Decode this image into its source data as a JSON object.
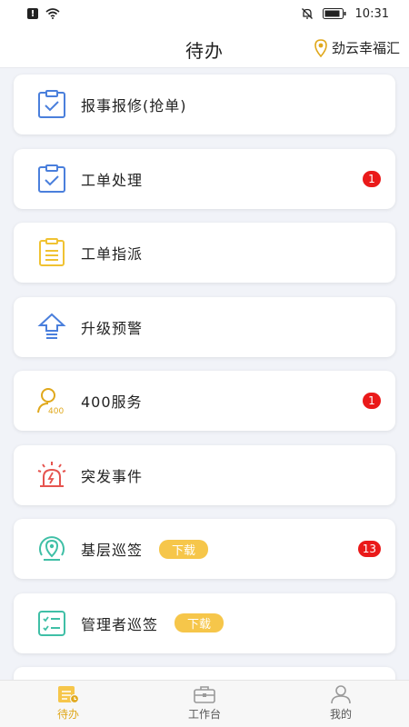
{
  "status_bar": {
    "time": "10:31"
  },
  "header": {
    "title": "待办",
    "location": "劲云幸福汇"
  },
  "items": [
    {
      "label": "报事报修(抢单)",
      "icon": "clipboard-check-icon",
      "color": "#4a7fdc"
    },
    {
      "label": "工单处理",
      "icon": "clipboard-check-icon",
      "color": "#4a7fdc",
      "badge": "1"
    },
    {
      "label": "工单指派",
      "icon": "clipboard-list-icon",
      "color": "#f0c232"
    },
    {
      "label": "升级预警",
      "icon": "upgrade-arrow-icon",
      "color": "#4a7fdc"
    },
    {
      "label": "400服务",
      "icon": "service-400-icon",
      "icon_text": "400",
      "color": "#e0a81c",
      "badge": "1"
    },
    {
      "label": "突发事件",
      "icon": "alarm-siren-icon",
      "color": "#e6544f"
    },
    {
      "label": "基层巡签",
      "icon": "patrol-location-icon",
      "color": "#3fbfa6",
      "tag": "下载",
      "badge": "13"
    },
    {
      "label": "管理者巡签",
      "icon": "checklist-icon",
      "color": "#3fbfa6",
      "tag": "下载"
    }
  ],
  "tabs": [
    {
      "label": "待办",
      "icon": "todo-icon",
      "active": true
    },
    {
      "label": "工作台",
      "icon": "toolbox-icon",
      "active": false
    },
    {
      "label": "我的",
      "icon": "user-icon",
      "active": false
    }
  ],
  "colors": {
    "accent": "#e0a81c",
    "badge": "#ea1a1a",
    "tag": "#f6c64a",
    "background": "#f1f3f8"
  }
}
